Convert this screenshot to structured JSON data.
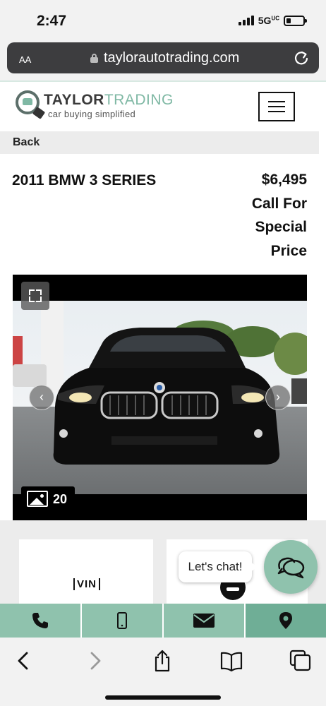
{
  "status_bar": {
    "time": "2:47",
    "network": "5G",
    "network_sup": "UC"
  },
  "browser": {
    "text_size_label": "AA",
    "url": "taylorautotrading.com"
  },
  "site": {
    "logo_title_part1": "TAYLOR",
    "logo_title_part2": "TRADING",
    "logo_tagline": "car buying simplified",
    "back_label": "Back"
  },
  "vehicle": {
    "title": "2011 BMW 3 SERIES",
    "price": "$6,495",
    "price_note_lines": [
      "Call For",
      "Special",
      "Price"
    ],
    "photo_count": "20"
  },
  "features": {
    "vin_label": "VIN"
  },
  "chat": {
    "bubble_text": "Let's chat!"
  },
  "icons": {
    "contact": [
      "phone-icon",
      "mobile-icon",
      "email-icon",
      "location-pin-icon"
    ],
    "toolbar": [
      "back-arrow-icon",
      "forward-arrow-icon",
      "share-icon",
      "bookmarks-icon",
      "tabs-icon"
    ]
  },
  "colors": {
    "brand_teal": "#8fc2ad",
    "brand_teal_dark": "#6fae96",
    "url_bar": "#3d3d3f"
  }
}
